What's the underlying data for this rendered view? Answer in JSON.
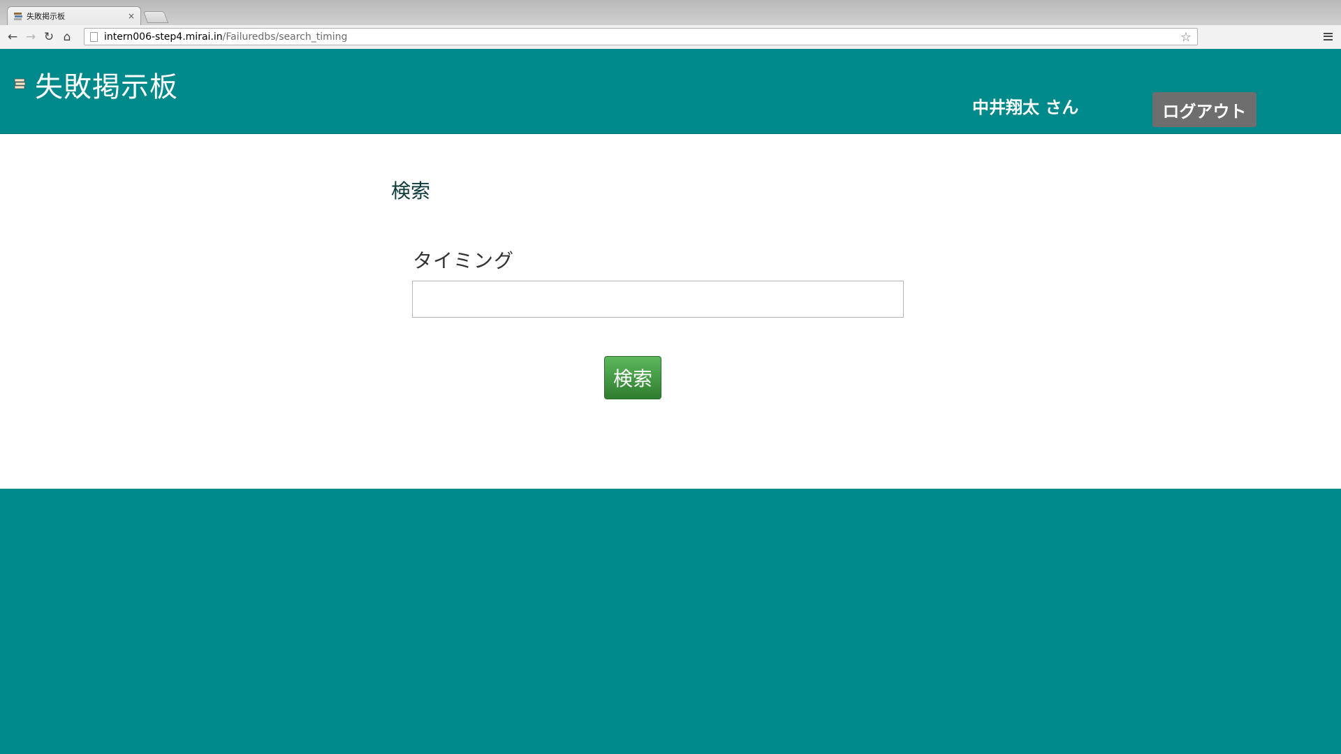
{
  "browser": {
    "tab_title": "失敗掲示板",
    "tab_close": "×",
    "url_host": "intern006-step4.mirai.in",
    "url_path": "/Failuredbs/search_timing",
    "back_glyph": "←",
    "forward_glyph": "→",
    "reload_glyph": "↻",
    "home_glyph": "⌂",
    "star_glyph": "☆"
  },
  "header": {
    "site_title": "失敗掲示板",
    "user_name": "中井翔太 さん",
    "logout_label": "ログアウト",
    "background_color": "#00898a"
  },
  "main": {
    "heading": "検索",
    "timing_field": {
      "label": "タイミング",
      "value": "",
      "placeholder": ""
    },
    "search_button_label": "検索",
    "search_button_color": "#4a9e4a"
  }
}
